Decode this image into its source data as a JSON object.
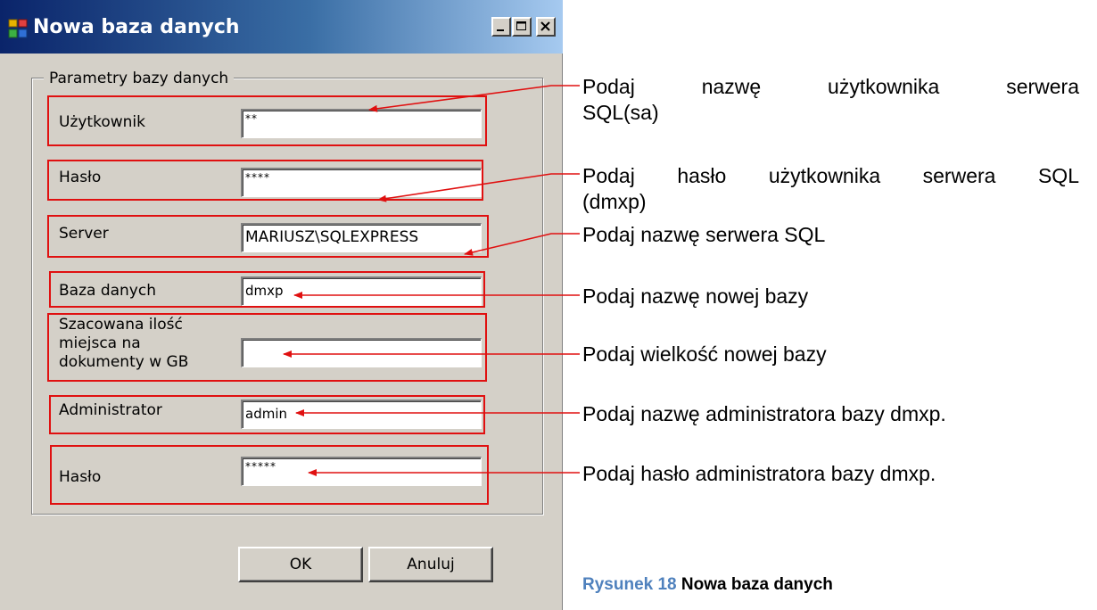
{
  "window": {
    "title": "Nowa baza danych",
    "accent": "#0a246a",
    "buttons": [
      "minimize",
      "maximize",
      "close"
    ]
  },
  "group": {
    "legend": "Parametry bazy danych"
  },
  "fields": {
    "user": {
      "label": "Użytkownik",
      "value": "**"
    },
    "password": {
      "label": "Hasło",
      "value": "****"
    },
    "server": {
      "label": "Server",
      "value": "MARIUSZ\\SQLEXPRESS"
    },
    "database": {
      "label": "Baza danych",
      "value": "dmxp"
    },
    "space": {
      "label_lines": [
        "Szacowana ilość",
        "miejsca na",
        "dokumenty w GB"
      ],
      "value": ""
    },
    "admin": {
      "label": "Administrator",
      "value": "admin"
    },
    "admin_password": {
      "label": "Hasło",
      "value": "*****"
    }
  },
  "buttons": {
    "ok": "OK",
    "cancel": "Anuluj"
  },
  "annotations": {
    "user": [
      "Podaj nazwę użytkownika serwera",
      "SQL(sa)"
    ],
    "password": [
      "Podaj hasło użytkownika serwera SQL",
      "(dmxp)"
    ],
    "server": "Podaj nazwę serwera SQL",
    "database": "Podaj nazwę nowej bazy",
    "space": "Podaj wielkość nowej bazy",
    "admin": "Podaj nazwę administratora bazy dmxp.",
    "admin_password": "Podaj hasło administratora bazy dmxp."
  },
  "caption": {
    "number": "Rysunek 18",
    "text": "Nowa baza danych"
  },
  "colors": {
    "highlight": "#e01010",
    "caption_number": "#4f81bd",
    "dialog_face": "#d4d0c8"
  }
}
